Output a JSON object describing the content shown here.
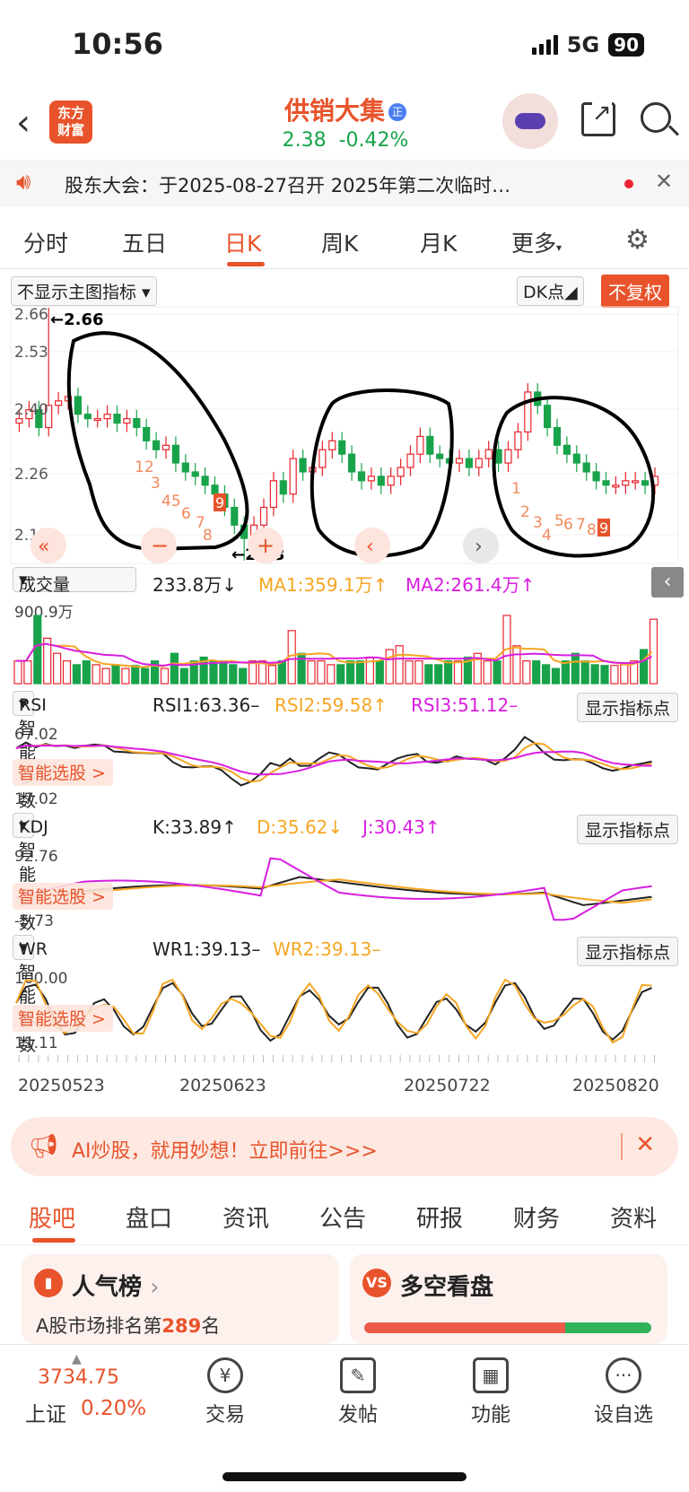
{
  "status": {
    "time": "10:56",
    "network": "5G",
    "battery": "90"
  },
  "header": {
    "logo_line1": "东方",
    "logo_line2": "财富",
    "stock_name": "供销大集",
    "badge": "正",
    "price": "2.38",
    "change_pct": "-0.42%"
  },
  "notice": {
    "text": "股东大会：于2025-08-27召开 2025年第二次临时…"
  },
  "tabs": [
    "分时",
    "五日",
    "日K",
    "周K",
    "月K",
    "更多"
  ],
  "chart_controls": {
    "main_indicator": "不显示主图指标",
    "dk": "DK点",
    "restore": "不复权"
  },
  "kline_labels": {
    "high": "2.66",
    "high_marker": "←2.66",
    "low_marker": "←2.13",
    "price_ticks": [
      "2.66",
      "2.53",
      "2.40",
      "2.26",
      "2.13"
    ]
  },
  "volume": {
    "label": "成交量",
    "value": "233.8万↓",
    "ma1": "MA1:359.1万↑",
    "ma2": "MA2:261.4万↑",
    "axis": "900.9万"
  },
  "rsi": {
    "label": "RSI 智能参数",
    "v1": "RSI1:63.36–",
    "v2": "RSI2:59.58↑",
    "v3": "RSI3:51.12–",
    "btn": "显示指标点",
    "top": "67.02",
    "bottom": "17.02",
    "smart": "智能选股 >"
  },
  "kdj": {
    "label": "KDJ 智能参数",
    "k": "K:33.89↑",
    "d": "D:35.62↓",
    "j": "J:30.43↑",
    "btn": "显示指标点",
    "top": "92.76",
    "bottom": "-5.73",
    "smart": "智能选股 >"
  },
  "wr": {
    "label": "WR 智能参数",
    "v1": "WR1:39.13–",
    "v2": "WR2:39.13–",
    "btn": "显示指标点",
    "top": "100.00",
    "bottom": "11.11",
    "smart": "智能选股 >"
  },
  "dates": [
    "20250523",
    "20250623",
    "20250722",
    "20250820"
  ],
  "banner": {
    "text": "AI炒股，就用妙想！立即前往>>>"
  },
  "subtabs": [
    "股吧",
    "盘口",
    "资讯",
    "公告",
    "研报",
    "财务",
    "资料"
  ],
  "cards": {
    "popular": {
      "title": "人气榜",
      "sub_prefix": "A股市场排名第",
      "rank": "289",
      "sub_suffix": "名"
    },
    "longshort": {
      "title": "多空看盘"
    }
  },
  "bottom": {
    "index_value": "3734.75",
    "index_name": "上证",
    "index_change": "0.20%",
    "nav": [
      "交易",
      "发帖",
      "功能",
      "设自选"
    ]
  },
  "chart_data": {
    "type": "candlestick",
    "price_range": [
      2.13,
      2.66
    ],
    "annotations": [
      "12",
      "3",
      "45",
      "6",
      "7",
      "8",
      "9",
      "1",
      "2",
      "3",
      "4",
      "5",
      "6",
      "7",
      "8",
      "9"
    ],
    "colors": {
      "up": "#e8232c",
      "down": "#18a34a",
      "ma1": "#f5a623",
      "ma2": "#d81ee0"
    }
  }
}
